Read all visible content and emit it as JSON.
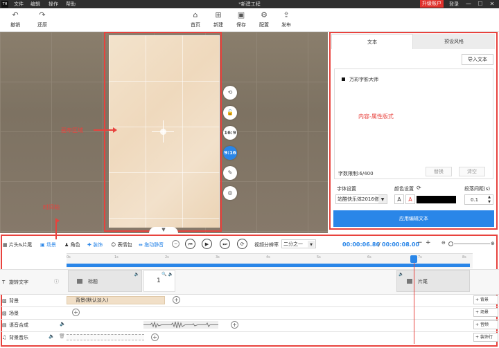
{
  "menubar": {
    "logo": "TH",
    "items": [
      "文件",
      "编辑",
      "操作",
      "帮助"
    ],
    "title": "*新建工程",
    "upgrade": "升级账户",
    "login": "登录",
    "window_controls": [
      "—",
      "☐",
      "✕"
    ]
  },
  "toolbar": {
    "undo": "撤销",
    "redo": "还原",
    "home": "首页",
    "new": "新建",
    "save": "保存",
    "config": "配置",
    "publish": "发布"
  },
  "canvas": {
    "annotation_canvas": "画布区域",
    "annotation_timeline": "时间轴",
    "side_buttons": [
      "⟲",
      "🔓",
      "16:9",
      "9:16",
      "✎",
      "◎"
    ],
    "collapse_glyph": "▼"
  },
  "right_panel": {
    "tabs": [
      "文本",
      "预设风格"
    ],
    "import_button": "导入文本",
    "editor_line": "万彩字影大师",
    "annotation_content": "内容-属性版式",
    "char_count_label": "字数限制:",
    "char_count_value": "6",
    "char_count_max": "/400",
    "replace_button": "替换",
    "clear_button": "清空",
    "font_setting_label": "字体设置",
    "color_setting_label": "颜色设置",
    "paragraph_spacing_label": "段落间距(s)",
    "font_value": "站酷快乐体2016修",
    "color_a1": "A",
    "color_a2": "A",
    "color_value": "#000000",
    "spacing_value": "0.1",
    "apply_button": "应用编辑文本"
  },
  "timeline_toolbar": {
    "items": [
      "片头&片尾",
      "场景",
      "角色",
      "装饰",
      "表情包",
      "拖动静音"
    ],
    "split_label": "视频分辨率",
    "split_value": "二分之一",
    "current_time": "00:00:06.86",
    "total_time": "00:00:08.00",
    "minus": "−",
    "plus": "+"
  },
  "ruler": {
    "ticks": [
      "0s",
      "1s",
      "2s",
      "3s",
      "4s",
      "5s",
      "6s",
      "7s",
      "8s"
    ]
  },
  "tracks": {
    "rows": [
      {
        "label": "旋转文字"
      },
      {
        "label": "背景"
      },
      {
        "label": "场景"
      },
      {
        "label": "语音合成"
      },
      {
        "label": "背景音乐"
      }
    ],
    "clip_title": "标题",
    "clip_end": "片尾",
    "clip_bg": "背景(默认淡入)",
    "clip_text_cursor": "1",
    "add_buttons": [
      "+ 背景",
      "+ 场景",
      "+ 音频",
      "+ 装饰行"
    ]
  },
  "colors": {
    "accent": "#2a86e8",
    "annotation": "#e8423d",
    "upgrade": "#e0322d"
  }
}
